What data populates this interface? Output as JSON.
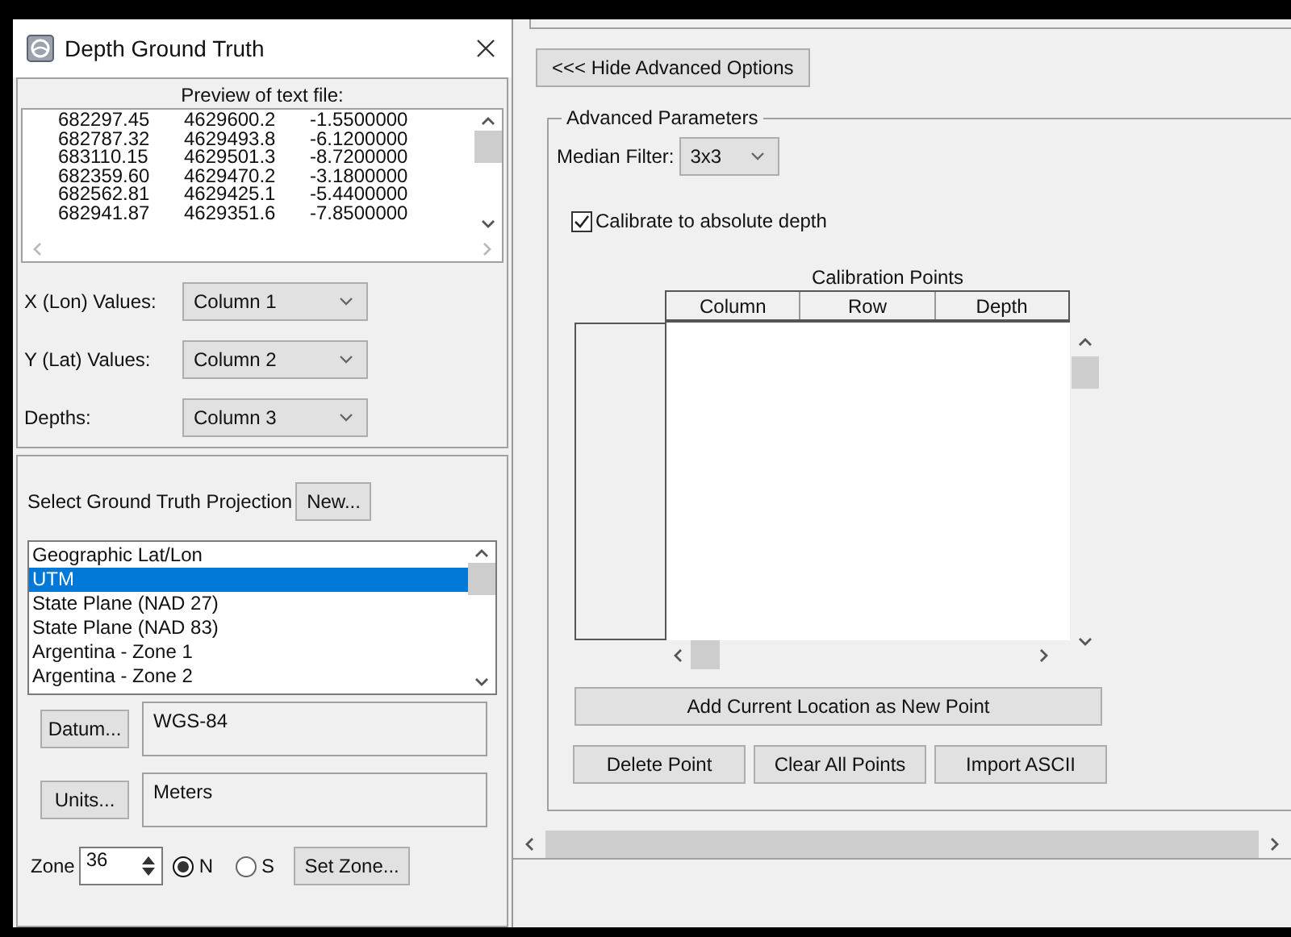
{
  "window": {
    "title": "Depth Ground Truth"
  },
  "preview": {
    "title": "Preview of text file:",
    "rows": [
      [
        "682297.45",
        "4629600.2",
        "-1.5500000"
      ],
      [
        "682787.32",
        "4629493.8",
        "-6.1200000"
      ],
      [
        "683110.15",
        "4629501.3",
        "-8.7200000"
      ],
      [
        "682359.60",
        "4629470.2",
        "-3.1800000"
      ],
      [
        "682562.81",
        "4629425.1",
        "-5.4400000"
      ],
      [
        "682941.87",
        "4629351.6",
        "-7.8500000"
      ]
    ]
  },
  "column_mappings": [
    {
      "label": "X (Lon) Values:",
      "value": "Column 1"
    },
    {
      "label": "Y (Lat) Values:",
      "value": "Column 2"
    },
    {
      "label": "Depths:",
      "value": "Column 3"
    }
  ],
  "projection": {
    "label": "Select Ground Truth Projection",
    "new_button": "New...",
    "items": [
      {
        "label": "Geographic Lat/Lon",
        "selected": false
      },
      {
        "label": "UTM",
        "selected": true
      },
      {
        "label": "State Plane (NAD 27)",
        "selected": false
      },
      {
        "label": "State Plane (NAD 83)",
        "selected": false
      },
      {
        "label": "Argentina - Zone 1",
        "selected": false
      },
      {
        "label": "Argentina - Zone 2",
        "selected": false
      }
    ],
    "datum_button": "Datum...",
    "datum": "WGS-84",
    "units_button": "Units...",
    "units": "Meters",
    "zone_label": "Zone",
    "zone": "36",
    "hemispheres": [
      {
        "label": "N",
        "selected": true
      },
      {
        "label": "S",
        "selected": false
      }
    ],
    "set_zone_button": "Set Zone..."
  },
  "advanced": {
    "toggle_button": "<<< Hide Advanced Options",
    "group_title": "Advanced Parameters",
    "median_filter": {
      "label": "Median Filter:",
      "value": "3x3"
    },
    "calibrate": {
      "label": "Calibrate to absolute depth",
      "checked": true
    },
    "calibration_points": {
      "title": "Calibration Points",
      "columns": [
        "Column",
        "Row",
        "Depth"
      ]
    },
    "add_button": "Add Current Location as New Point",
    "buttons": [
      "Delete Point",
      "Clear All Points",
      "Import ASCII"
    ]
  }
}
